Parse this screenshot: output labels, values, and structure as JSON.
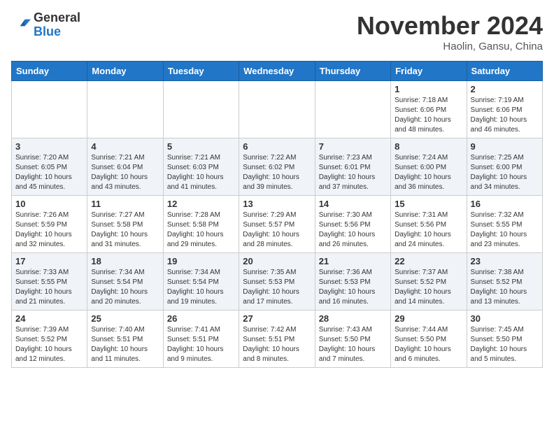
{
  "header": {
    "logo_line1": "General",
    "logo_line2": "Blue",
    "month_title": "November 2024",
    "subtitle": "Haolin, Gansu, China"
  },
  "days_of_week": [
    "Sunday",
    "Monday",
    "Tuesday",
    "Wednesday",
    "Thursday",
    "Friday",
    "Saturday"
  ],
  "weeks": [
    [
      {
        "day": "",
        "info": ""
      },
      {
        "day": "",
        "info": ""
      },
      {
        "day": "",
        "info": ""
      },
      {
        "day": "",
        "info": ""
      },
      {
        "day": "",
        "info": ""
      },
      {
        "day": "1",
        "info": "Sunrise: 7:18 AM\nSunset: 6:06 PM\nDaylight: 10 hours\nand 48 minutes."
      },
      {
        "day": "2",
        "info": "Sunrise: 7:19 AM\nSunset: 6:06 PM\nDaylight: 10 hours\nand 46 minutes."
      }
    ],
    [
      {
        "day": "3",
        "info": "Sunrise: 7:20 AM\nSunset: 6:05 PM\nDaylight: 10 hours\nand 45 minutes."
      },
      {
        "day": "4",
        "info": "Sunrise: 7:21 AM\nSunset: 6:04 PM\nDaylight: 10 hours\nand 43 minutes."
      },
      {
        "day": "5",
        "info": "Sunrise: 7:21 AM\nSunset: 6:03 PM\nDaylight: 10 hours\nand 41 minutes."
      },
      {
        "day": "6",
        "info": "Sunrise: 7:22 AM\nSunset: 6:02 PM\nDaylight: 10 hours\nand 39 minutes."
      },
      {
        "day": "7",
        "info": "Sunrise: 7:23 AM\nSunset: 6:01 PM\nDaylight: 10 hours\nand 37 minutes."
      },
      {
        "day": "8",
        "info": "Sunrise: 7:24 AM\nSunset: 6:00 PM\nDaylight: 10 hours\nand 36 minutes."
      },
      {
        "day": "9",
        "info": "Sunrise: 7:25 AM\nSunset: 6:00 PM\nDaylight: 10 hours\nand 34 minutes."
      }
    ],
    [
      {
        "day": "10",
        "info": "Sunrise: 7:26 AM\nSunset: 5:59 PM\nDaylight: 10 hours\nand 32 minutes."
      },
      {
        "day": "11",
        "info": "Sunrise: 7:27 AM\nSunset: 5:58 PM\nDaylight: 10 hours\nand 31 minutes."
      },
      {
        "day": "12",
        "info": "Sunrise: 7:28 AM\nSunset: 5:58 PM\nDaylight: 10 hours\nand 29 minutes."
      },
      {
        "day": "13",
        "info": "Sunrise: 7:29 AM\nSunset: 5:57 PM\nDaylight: 10 hours\nand 28 minutes."
      },
      {
        "day": "14",
        "info": "Sunrise: 7:30 AM\nSunset: 5:56 PM\nDaylight: 10 hours\nand 26 minutes."
      },
      {
        "day": "15",
        "info": "Sunrise: 7:31 AM\nSunset: 5:56 PM\nDaylight: 10 hours\nand 24 minutes."
      },
      {
        "day": "16",
        "info": "Sunrise: 7:32 AM\nSunset: 5:55 PM\nDaylight: 10 hours\nand 23 minutes."
      }
    ],
    [
      {
        "day": "17",
        "info": "Sunrise: 7:33 AM\nSunset: 5:55 PM\nDaylight: 10 hours\nand 21 minutes."
      },
      {
        "day": "18",
        "info": "Sunrise: 7:34 AM\nSunset: 5:54 PM\nDaylight: 10 hours\nand 20 minutes."
      },
      {
        "day": "19",
        "info": "Sunrise: 7:34 AM\nSunset: 5:54 PM\nDaylight: 10 hours\nand 19 minutes."
      },
      {
        "day": "20",
        "info": "Sunrise: 7:35 AM\nSunset: 5:53 PM\nDaylight: 10 hours\nand 17 minutes."
      },
      {
        "day": "21",
        "info": "Sunrise: 7:36 AM\nSunset: 5:53 PM\nDaylight: 10 hours\nand 16 minutes."
      },
      {
        "day": "22",
        "info": "Sunrise: 7:37 AM\nSunset: 5:52 PM\nDaylight: 10 hours\nand 14 minutes."
      },
      {
        "day": "23",
        "info": "Sunrise: 7:38 AM\nSunset: 5:52 PM\nDaylight: 10 hours\nand 13 minutes."
      }
    ],
    [
      {
        "day": "24",
        "info": "Sunrise: 7:39 AM\nSunset: 5:52 PM\nDaylight: 10 hours\nand 12 minutes."
      },
      {
        "day": "25",
        "info": "Sunrise: 7:40 AM\nSunset: 5:51 PM\nDaylight: 10 hours\nand 11 minutes."
      },
      {
        "day": "26",
        "info": "Sunrise: 7:41 AM\nSunset: 5:51 PM\nDaylight: 10 hours\nand 9 minutes."
      },
      {
        "day": "27",
        "info": "Sunrise: 7:42 AM\nSunset: 5:51 PM\nDaylight: 10 hours\nand 8 minutes."
      },
      {
        "day": "28",
        "info": "Sunrise: 7:43 AM\nSunset: 5:50 PM\nDaylight: 10 hours\nand 7 minutes."
      },
      {
        "day": "29",
        "info": "Sunrise: 7:44 AM\nSunset: 5:50 PM\nDaylight: 10 hours\nand 6 minutes."
      },
      {
        "day": "30",
        "info": "Sunrise: 7:45 AM\nSunset: 5:50 PM\nDaylight: 10 hours\nand 5 minutes."
      }
    ]
  ]
}
